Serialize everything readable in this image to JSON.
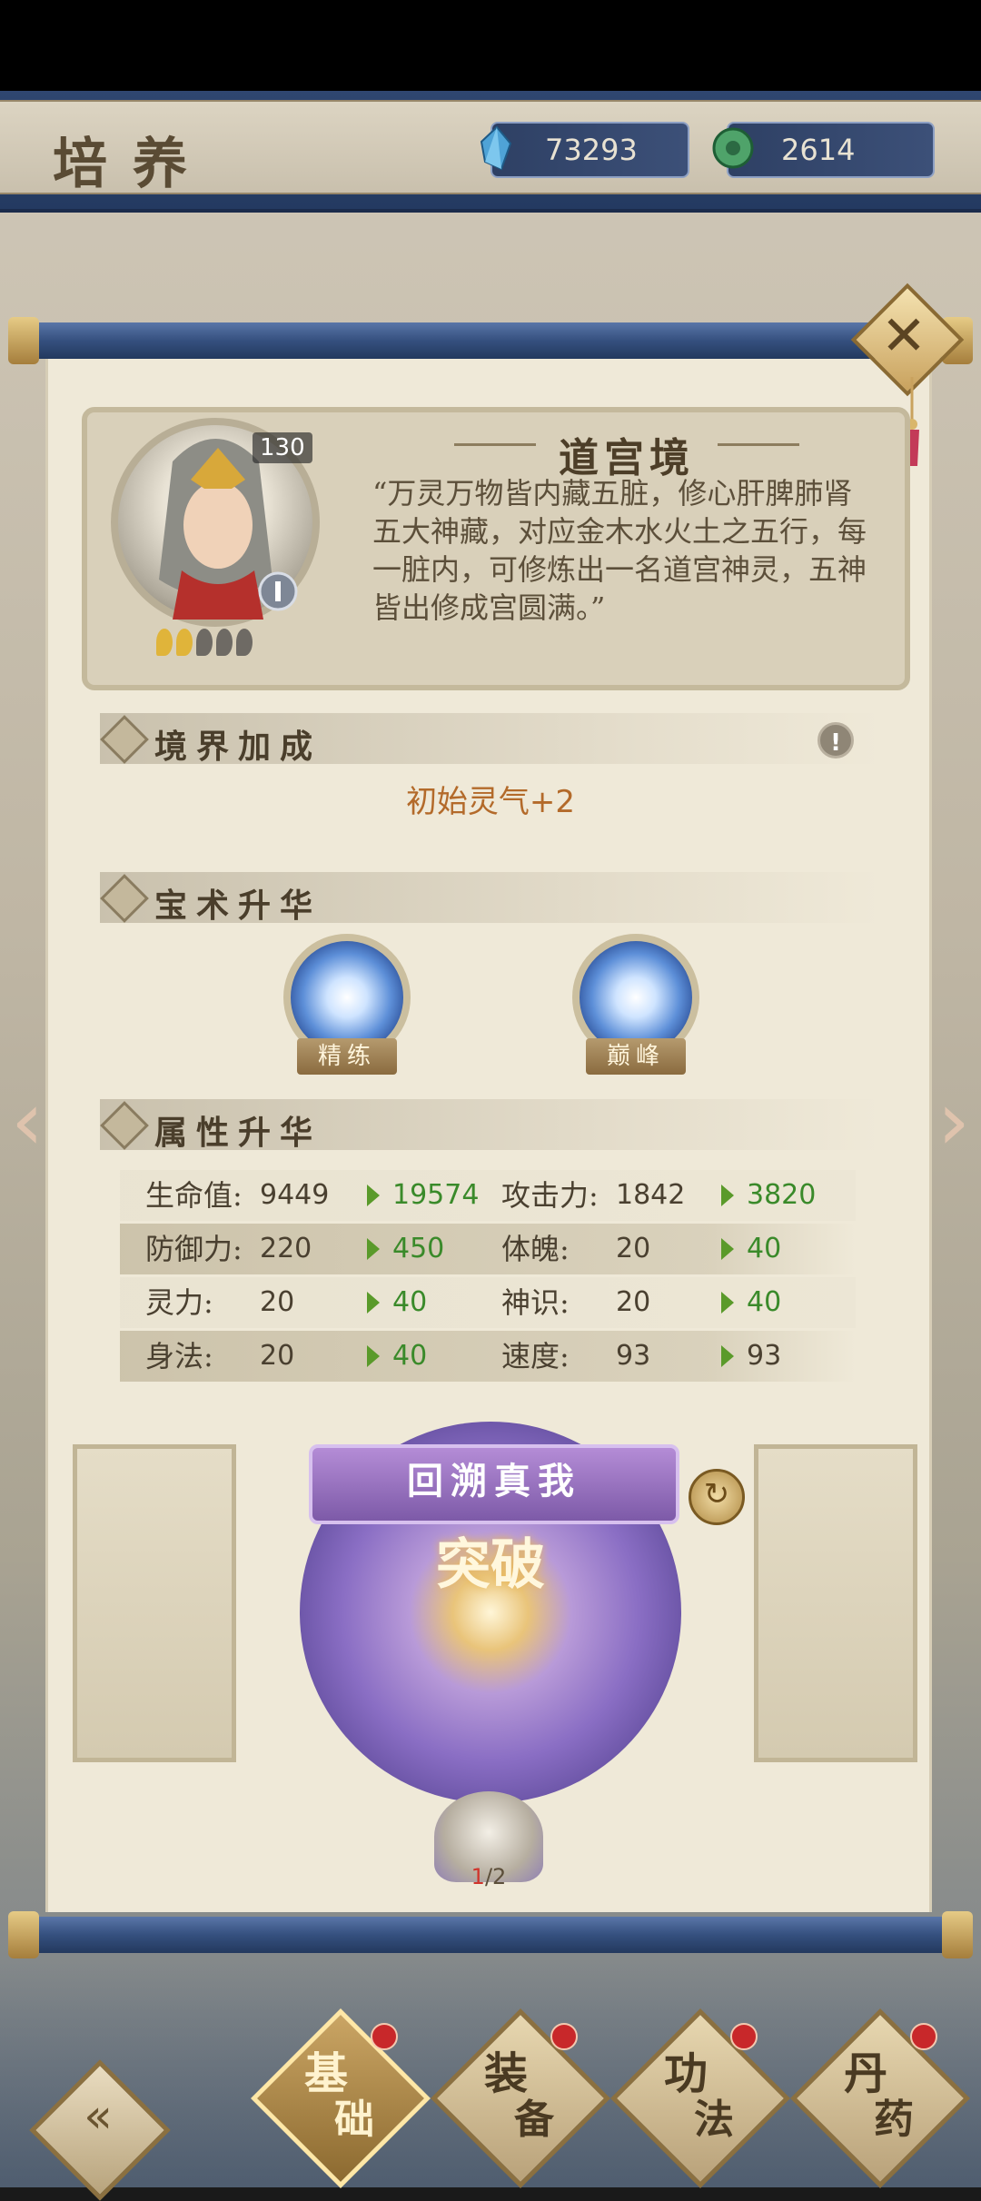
{
  "header": {
    "title": "培养",
    "resources": [
      {
        "icon": "spirit-crystal-icon",
        "value": "73293"
      },
      {
        "icon": "jade-coin-icon",
        "value": "2614"
      }
    ]
  },
  "realm": {
    "level": "130",
    "stars_filled": 2,
    "stars_total": 5,
    "name": "道宫境",
    "description": "“万灵万物皆内藏五脏，修心肝脾肺肾五大神藏，对应金木水火土之五行，每一脏内，可修炼出一名道宫神灵，五神皆出修成宫圆满。”"
  },
  "sections": {
    "realm_bonus": "境界加成",
    "skill_sublimation": "宝术升华",
    "attribute_sublimation": "属性升华"
  },
  "realm_bonus_text": "初始灵气+2",
  "skills": [
    {
      "label": "精练"
    },
    {
      "label": "巅峰"
    }
  ],
  "attributes": [
    {
      "name": "生命值:",
      "current": "9449",
      "next": "19574"
    },
    {
      "name": "攻击力:",
      "current": "1842",
      "next": "3820"
    },
    {
      "name": "防御力:",
      "current": "220",
      "next": "450"
    },
    {
      "name": "体魄:",
      "current": "20",
      "next": "40"
    },
    {
      "name": "灵力:",
      "current": "20",
      "next": "40"
    },
    {
      "name": "神识:",
      "current": "20",
      "next": "40"
    },
    {
      "name": "身法:",
      "current": "20",
      "next": "40"
    },
    {
      "name": "速度:",
      "current": "93",
      "next": "93"
    }
  ],
  "breakthrough": {
    "banner": "回溯真我",
    "center": "突破",
    "cost_current": "1",
    "cost_total": "/2"
  },
  "tabs": [
    {
      "t1": "基",
      "t2": "础",
      "active": true
    },
    {
      "t1": "装",
      "t2": "备",
      "active": false
    },
    {
      "t1": "功",
      "t2": "法",
      "active": false
    },
    {
      "t1": "丹",
      "t2": "药",
      "active": false
    }
  ],
  "colors": {
    "accent_gold": "#c9a25e",
    "stat_green": "#3a8a2a",
    "bonus_orange": "#b36a2a",
    "notification_red": "#c8282a"
  }
}
